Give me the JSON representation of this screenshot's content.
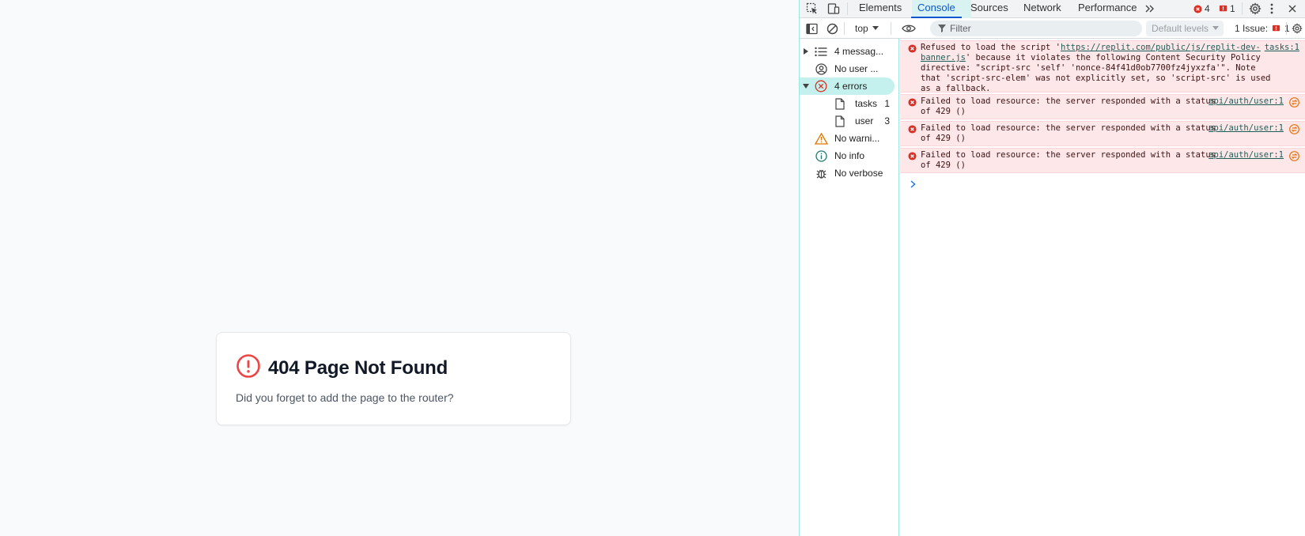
{
  "page": {
    "title": "404 Page Not Found",
    "message": "Did you forget to add the page to the router?"
  },
  "devtools": {
    "tabs": [
      {
        "label": "Elements"
      },
      {
        "label": "Console"
      },
      {
        "label": "Sources"
      },
      {
        "label": "Network"
      },
      {
        "label": "Performance"
      }
    ],
    "error_count": "4",
    "issue_count": "1",
    "toolbar": {
      "context": "top",
      "filter_placeholder": "Filter",
      "levels": "Default levels",
      "issues_label": "1 Issue:",
      "issues_count": "1"
    },
    "sidebar": {
      "items": [
        {
          "label": "4 messag...",
          "icon": "list-icon"
        },
        {
          "label": "No user ...",
          "icon": "user-icon"
        },
        {
          "label": "4 errors",
          "icon": "error-icon"
        },
        {
          "label": "tasks",
          "count": "1",
          "icon": "file-icon"
        },
        {
          "label": "user",
          "count": "3",
          "icon": "file-icon"
        },
        {
          "label": "No warni...",
          "icon": "warning-icon"
        },
        {
          "label": "No info",
          "icon": "info-icon"
        },
        {
          "label": "No verbose",
          "icon": "bug-icon"
        }
      ]
    },
    "messages": [
      {
        "text_before": "Refused to load the script '",
        "link": "https://replit.com/public/js/replit-dev-banner.js",
        "text_after": "' because it violates the following Content Security Policy directive: \"script-src 'self' 'nonce-84f41d0ob7700fz4jyxzfa'\". Note that 'script-src-elem' was not explicitly set, so 'script-src' is used as a fallback.",
        "source": "tasks:1"
      },
      {
        "text": "Failed to load resource: the server responded with a status of 429 ()",
        "source": "api/auth/user:1"
      },
      {
        "text": "Failed to load resource: the server responded with a status of 429 ()",
        "source": "api/auth/user:1"
      },
      {
        "text": "Failed to load resource: the server responded with a status of 429 ()",
        "source": "api/auth/user:1"
      }
    ],
    "colors": {
      "accent": "#0b57d0",
      "error": "#d93025",
      "error_bg": "#fde7e9",
      "selection": "#c4f1ee"
    }
  }
}
